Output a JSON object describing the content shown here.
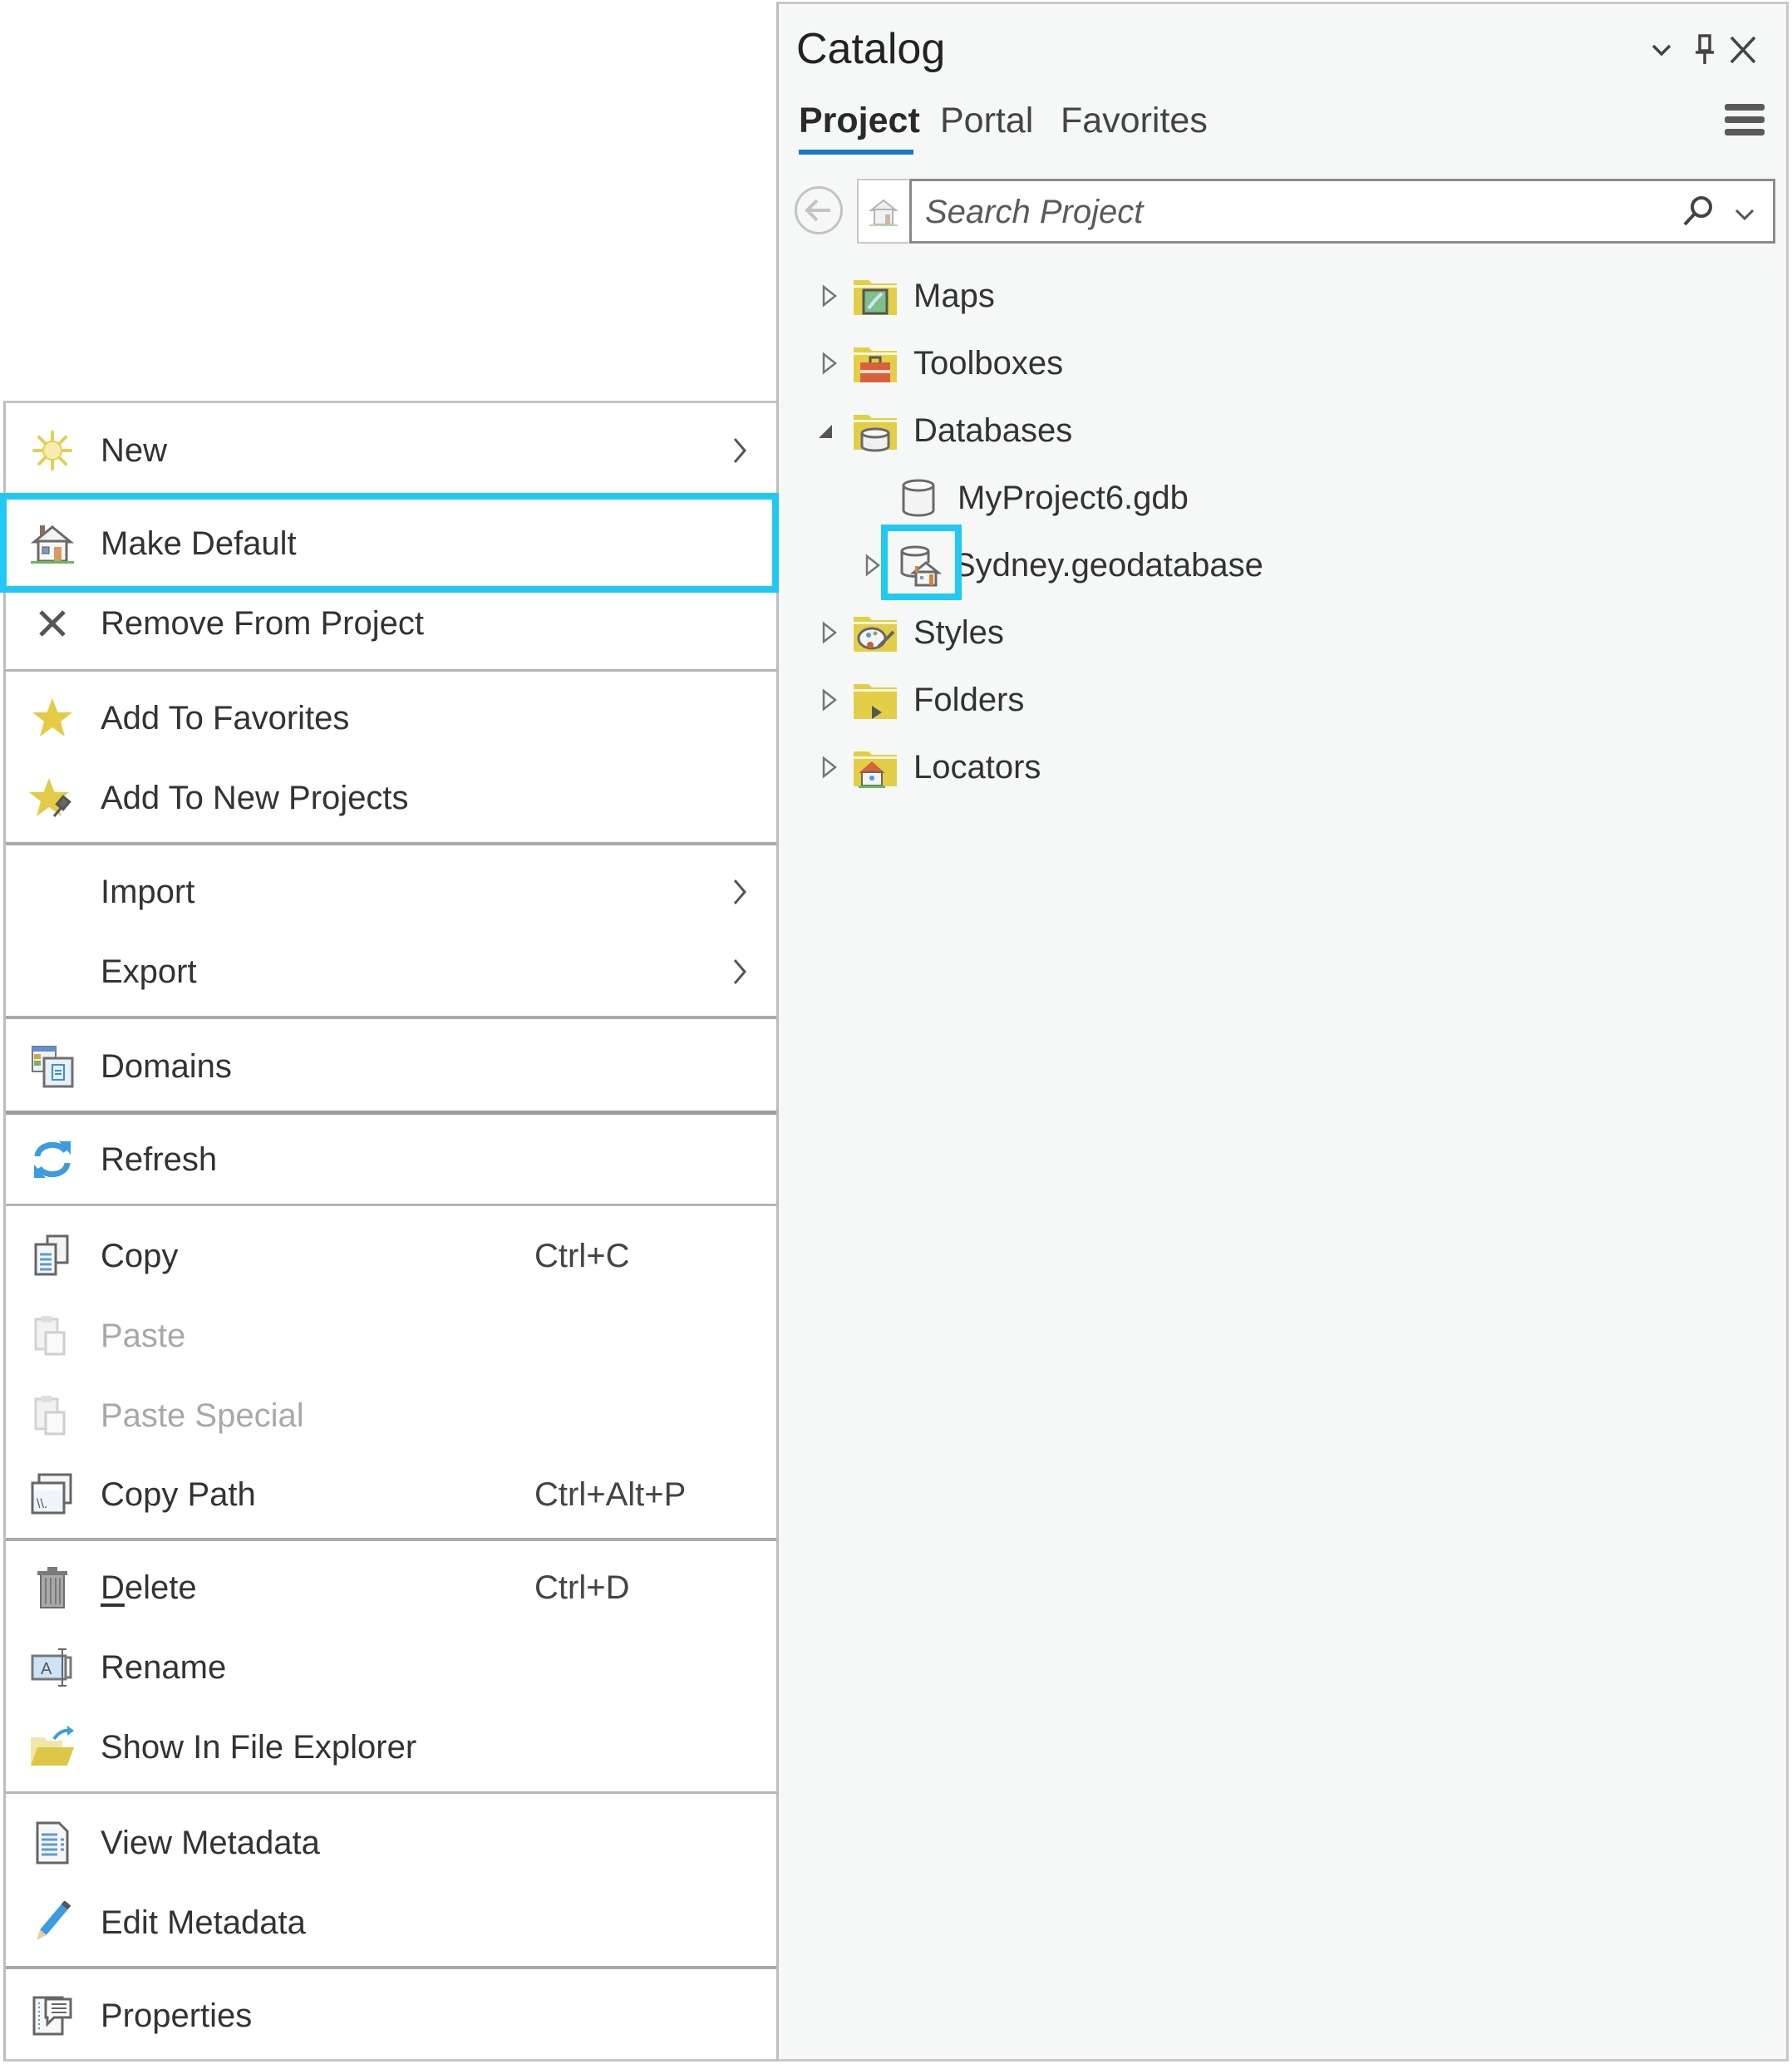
{
  "colors": {
    "highlight": "#22c8f4",
    "tab_accent": "#1b79c8",
    "folder": "#e2cf47",
    "text": "#333333",
    "disabled_text": "#a8a8a8"
  },
  "context_menu": {
    "items": [
      {
        "label": "New",
        "icon": "new-sparkle-icon",
        "submenu": true,
        "enabled": true
      },
      {
        "label": "Make Default",
        "icon": "home-icon",
        "enabled": true,
        "highlighted": true
      },
      {
        "label": "Remove From Project",
        "icon": "close-x-icon",
        "enabled": true
      },
      {
        "label": "Add To Favorites",
        "icon": "star-icon",
        "enabled": true
      },
      {
        "label": "Add To New Projects",
        "icon": "star-pin-icon",
        "enabled": true
      },
      {
        "label": "Import",
        "icon": null,
        "submenu": true,
        "enabled": true
      },
      {
        "label": "Export",
        "icon": null,
        "submenu": true,
        "enabled": true
      },
      {
        "label": "Domains",
        "icon": "domains-icon",
        "enabled": true
      },
      {
        "label": "Refresh",
        "icon": "refresh-icon",
        "enabled": true
      },
      {
        "label": "Copy",
        "icon": "copy-icon",
        "shortcut": "Ctrl+C",
        "enabled": true
      },
      {
        "label": "Paste",
        "icon": "paste-icon",
        "enabled": false
      },
      {
        "label": "Paste Special",
        "icon": "paste-special-icon",
        "enabled": false
      },
      {
        "label": "Copy Path",
        "icon": "copy-path-icon",
        "shortcut": "Ctrl+Alt+P",
        "enabled": true
      },
      {
        "label": "Delete",
        "icon": "trash-icon",
        "shortcut": "Ctrl+D",
        "enabled": true,
        "access_key": "D"
      },
      {
        "label": "Rename",
        "icon": "rename-icon",
        "enabled": true
      },
      {
        "label": "Show In File Explorer",
        "icon": "open-folder-icon",
        "enabled": true
      },
      {
        "label": "View Metadata",
        "icon": "metadata-document-icon",
        "enabled": true
      },
      {
        "label": "Edit Metadata",
        "icon": "pencil-icon",
        "enabled": true
      },
      {
        "label": "Properties",
        "icon": "properties-icon",
        "enabled": true
      }
    ],
    "delete_rest": "elete",
    "delete_key": "D"
  },
  "catalog": {
    "title": "Catalog",
    "window_buttons": {
      "options": "chevron-down-icon",
      "pin": "pin-icon",
      "close": "close-icon"
    },
    "tabs": [
      {
        "label": "Project",
        "active": true
      },
      {
        "label": "Portal",
        "active": false
      },
      {
        "label": "Favorites",
        "active": false
      }
    ],
    "search": {
      "placeholder": "Search Project",
      "value": ""
    },
    "tree": [
      {
        "label": "Maps",
        "icon": "maps-folder-icon",
        "level": 0,
        "expander": "collapsed"
      },
      {
        "label": "Toolboxes",
        "icon": "toolboxes-folder-icon",
        "level": 0,
        "expander": "collapsed"
      },
      {
        "label": "Databases",
        "icon": "databases-folder-icon",
        "level": 0,
        "expander": "expanded"
      },
      {
        "label": "MyProject6.gdb",
        "icon": "geodatabase-icon",
        "level": 1,
        "expander": "none"
      },
      {
        "label": "Sydney.geodatabase",
        "icon": "default-geodatabase-icon",
        "level": 1,
        "expander": "collapsed",
        "highlighted": true
      },
      {
        "label": "Styles",
        "icon": "styles-folder-icon",
        "level": 0,
        "expander": "collapsed"
      },
      {
        "label": "Folders",
        "icon": "folders-folder-icon",
        "level": 0,
        "expander": "collapsed"
      },
      {
        "label": "Locators",
        "icon": "locators-folder-icon",
        "level": 0,
        "expander": "collapsed"
      }
    ]
  }
}
